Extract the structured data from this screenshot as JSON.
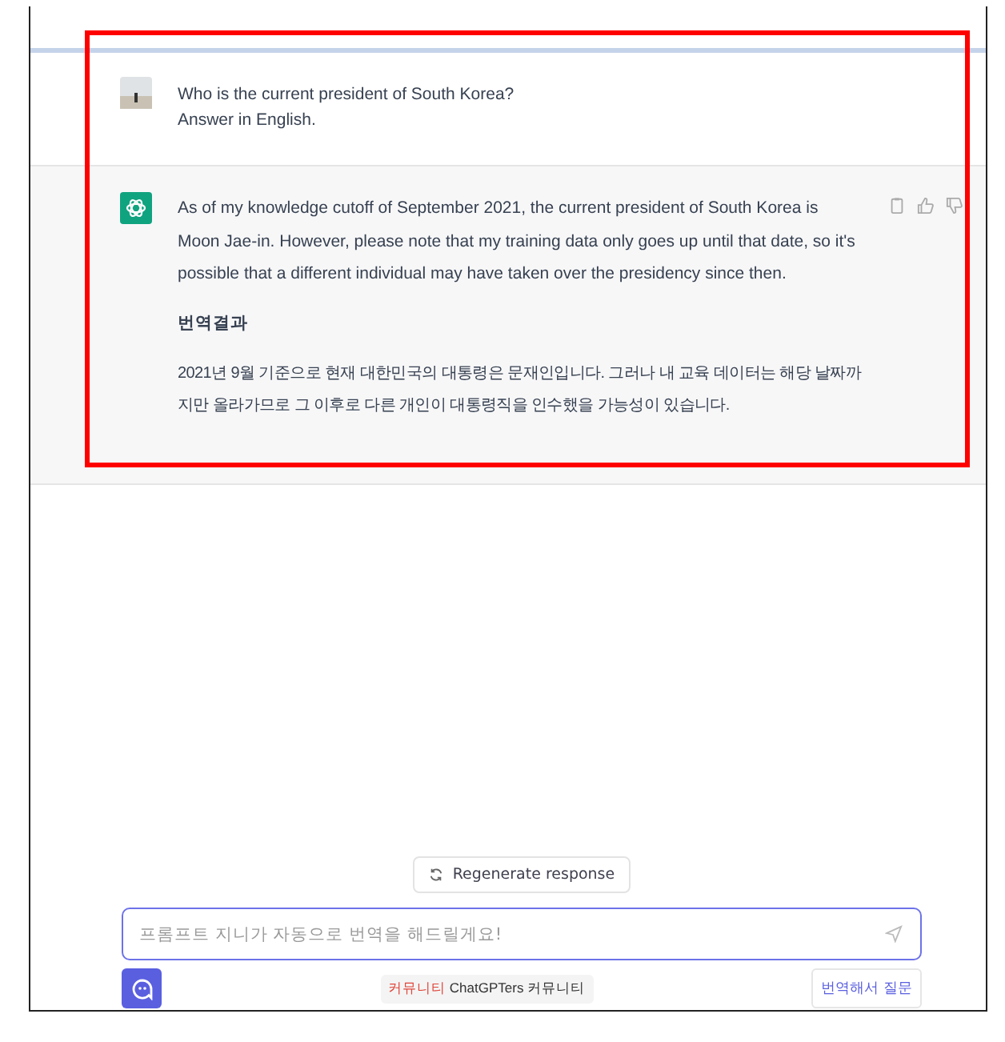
{
  "conversation": [
    {
      "kind": "user",
      "lines": [
        "Who is the current president of South Korea?",
        "Answer in English."
      ]
    },
    {
      "kind": "assistant",
      "paragraphs": [
        "As of my knowledge cutoff of September 2021, the current president of South Korea is Moon Jae-in. However, please note that my training data only goes up until that date, so it's possible that a different individual may have taken over the presidency since then."
      ],
      "translation_heading": "번역결과",
      "translation": "2021년 9월 기준으로 현재 대한민국의 대통령은 문재인입니다. 그러나 내 교육 데이터는 해당 날짜까지만 올라가므로 그 이후로 다른 개인이 대통령직을 인수했을 가능성이 있습니다."
    }
  ],
  "regenerate_button": "Regenerate response",
  "prompt": {
    "placeholder": "프롬프트 지니가 자동으로 번역을 해드릴게요!"
  },
  "community": {
    "tag": "커뮤니티",
    "label": "ChatGPTers 커뮤니티"
  },
  "translate_button": "번역해서 질문"
}
